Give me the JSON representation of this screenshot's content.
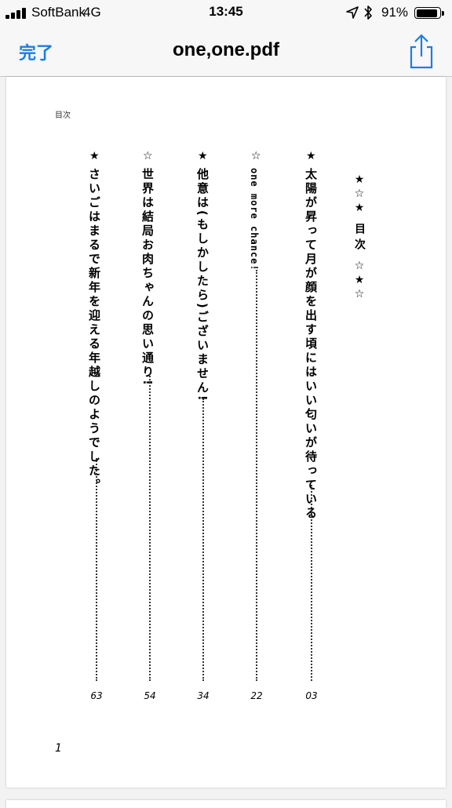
{
  "status_bar": {
    "carrier": "SoftBank",
    "network": "4G",
    "time": "13:45",
    "battery_percent": "91%",
    "battery_level": 0.91
  },
  "nav": {
    "done_label": "完了",
    "title": "one,one.pdf",
    "accent_color": "#1a7ee6"
  },
  "document": {
    "heading_small": "目次",
    "title_stars_top": [
      "★",
      "☆",
      "★"
    ],
    "title": "目次",
    "title_stars_bottom": [
      "☆",
      "★",
      "☆"
    ],
    "toc": [
      {
        "star": "★",
        "title": "太陽が昇って月が顔を出す頃にはいい匂いが待っている",
        "page": "03"
      },
      {
        "star": "☆",
        "title": "one more chance!",
        "page": "22"
      },
      {
        "star": "★",
        "title": "他意は(もしかしたら)ございません!",
        "page": "34"
      },
      {
        "star": "☆",
        "title": "世界は結局お肉ちゃんの思い通り!",
        "page": "54"
      },
      {
        "star": "★",
        "title": "さいごはまるで新年を迎える年越しのようでした。",
        "page": "63"
      }
    ],
    "folio": "1"
  }
}
